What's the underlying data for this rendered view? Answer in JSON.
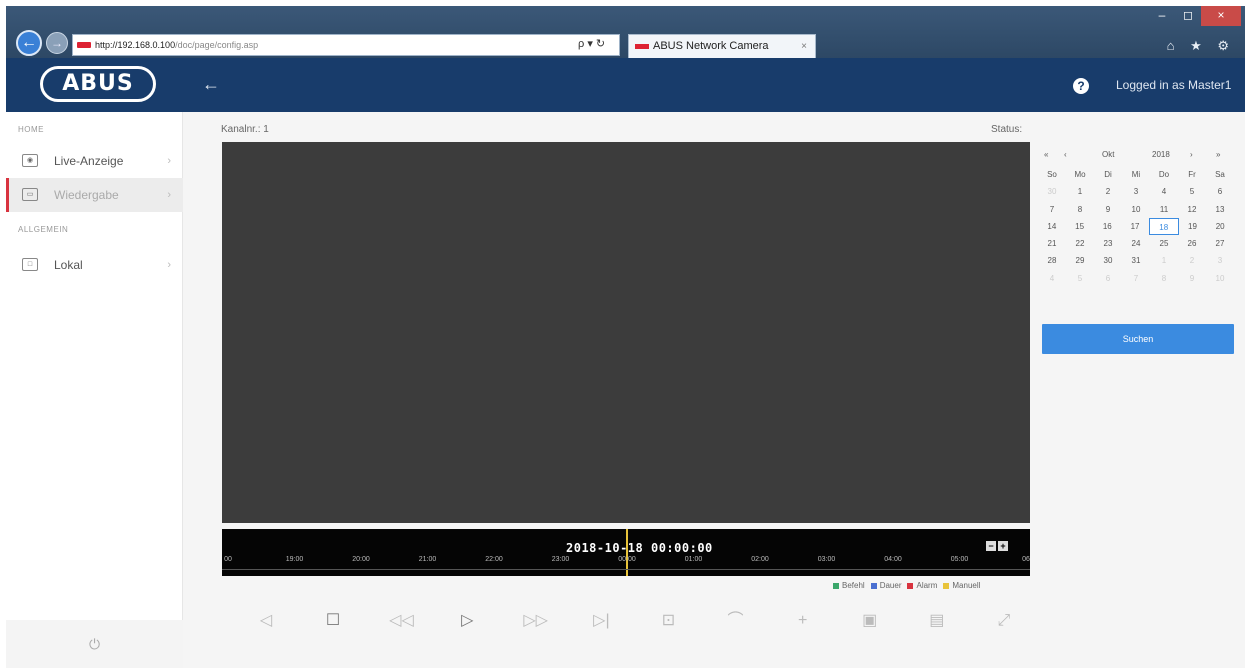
{
  "browser": {
    "url_host": "http://192.168.0.100",
    "url_path": "/doc/page/config.asp",
    "addr_tools": "ρ ▾ ↻",
    "tab_title": "ABUS Network Camera",
    "tab_close": "×",
    "window_controls": [
      "–",
      "◻",
      "×"
    ],
    "toolbar_icons": "⌂ ★ ⚙"
  },
  "header": {
    "logo": "ABUS",
    "back": "←",
    "help": "?",
    "login_status": "Logged in as Master1"
  },
  "sidebar": {
    "section_home": "HOME",
    "section_allgemein": "ALLGEMEIN",
    "items": [
      {
        "label": "Live-Anzeige",
        "icon": "camera-icon",
        "glyph": "◉"
      },
      {
        "label": "Wiedergabe",
        "icon": "playback-icon",
        "glyph": "▭"
      },
      {
        "label": "Lokal",
        "icon": "local-settings-icon",
        "glyph": "□"
      }
    ],
    "chevron": "›",
    "power": "⏻"
  },
  "main": {
    "kanal": "Kanalnr.: 1",
    "status": "Status:"
  },
  "timeline": {
    "datetime": "2018-10-18 00:00:00",
    "zoom_out": "−",
    "zoom_in": "+",
    "ticks": [
      "00",
      "19:00",
      "20:00",
      "21:00",
      "22:00",
      "23:00",
      "00:00",
      "01:00",
      "02:00",
      "03:00",
      "04:00",
      "05:00",
      "06"
    ],
    "legend": [
      {
        "label": "Befehl",
        "color": "#3aa66a"
      },
      {
        "label": "Dauer",
        "color": "#4a6fd1"
      },
      {
        "label": "Alarm",
        "color": "#d8333f"
      },
      {
        "label": "Manuell",
        "color": "#e8c33a"
      }
    ]
  },
  "controls": [
    {
      "name": "volume-icon",
      "glyph": "◁"
    },
    {
      "name": "stop-icon",
      "glyph": "☐"
    },
    {
      "name": "slow-down-icon",
      "glyph": "◁◁"
    },
    {
      "name": "play-icon",
      "glyph": "▷"
    },
    {
      "name": "fast-forward-icon",
      "glyph": "▷▷"
    },
    {
      "name": "single-frame-icon",
      "glyph": "▷|"
    },
    {
      "name": "snapshot-icon",
      "glyph": "⊡"
    },
    {
      "name": "clip-icon",
      "glyph": "⌒"
    },
    {
      "name": "digital-zoom-icon",
      "glyph": "+"
    },
    {
      "name": "image-download-icon",
      "glyph": "▣"
    },
    {
      "name": "video-download-icon",
      "glyph": "▤"
    },
    {
      "name": "fullscreen-icon",
      "glyph": "⤢"
    }
  ],
  "calendar": {
    "nav_prev_year": "«",
    "nav_prev_month": "‹",
    "month": "Okt",
    "year": "2018",
    "nav_next_month": "›",
    "nav_next_year": "»",
    "weekdays": [
      "So",
      "Mo",
      "Di",
      "Mi",
      "Do",
      "Fr",
      "Sa"
    ],
    "weeks": [
      [
        "30",
        "1",
        "2",
        "3",
        "4",
        "5",
        "6"
      ],
      [
        "7",
        "8",
        "9",
        "10",
        "11",
        "12",
        "13"
      ],
      [
        "14",
        "15",
        "16",
        "17",
        "18",
        "19",
        "20"
      ],
      [
        "21",
        "22",
        "23",
        "24",
        "25",
        "26",
        "27"
      ],
      [
        "28",
        "29",
        "30",
        "31",
        "1",
        "2",
        "3"
      ],
      [
        "4",
        "5",
        "6",
        "7",
        "8",
        "9",
        "10"
      ]
    ],
    "selected_day": "18",
    "search_label": "Suchen"
  }
}
